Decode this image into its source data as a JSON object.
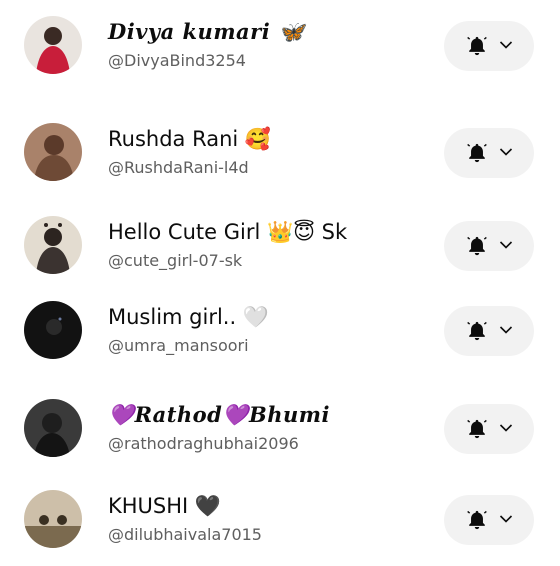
{
  "subscriptions": [
    {
      "name": "𝑫𝒊𝒗𝒚𝒂 𝒌𝒖𝒎𝒂𝒓𝒊 🦋",
      "handle": "@DivyaBind3254",
      "avatar_color": "#c81e3a"
    },
    {
      "name": "Rushda Rani 🥰",
      "handle": "@RushdaRani-l4d",
      "avatar_color": "#8a5a3c"
    },
    {
      "name": "Hello Cute Girl 👑😇 Sk",
      "handle": "@cute_girl-07-sk",
      "avatar_color": "#d8cfc2"
    },
    {
      "name": "Muslim girl.. 🤍",
      "handle": "@umra_mansoori",
      "avatar_color": "#151515"
    },
    {
      "name": "💜𝑹𝒂𝒕𝒉𝒐𝒅💜𝑩𝒉𝒖𝒎𝒊",
      "handle": "@rathodraghubhai2096",
      "avatar_color": "#2a2a2a"
    },
    {
      "name": "KHUSHI 🖤",
      "handle": "@dilubhaivala7015",
      "avatar_color": "#b8a48a"
    }
  ],
  "icons": {
    "bell": "bell-icon",
    "chevron": "chevron-down-icon"
  },
  "colors": {
    "background": "#ffffff",
    "button_bg": "#f2f2f2",
    "handle_text": "#5f5f5f"
  }
}
